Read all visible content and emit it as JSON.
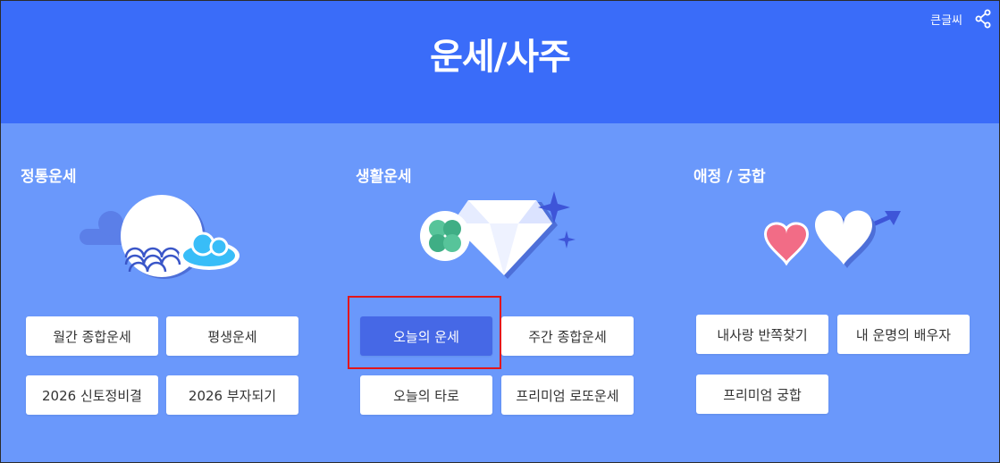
{
  "header": {
    "title": "운세/사주",
    "font_size_label": "큰글씨"
  },
  "icons": {
    "share": "share-icon",
    "moon": "moon-cloud-illustration",
    "gem": "diamond-clover-illustration",
    "hearts": "hearts-arrow-illustration"
  },
  "colors": {
    "header_bg": "#3a6cf9",
    "content_bg": "#6a98fb",
    "active_button": "#4668e6",
    "highlight_border": "#e3151a"
  },
  "sections": [
    {
      "title": "정통운세",
      "buttons": [
        "월간 종합운세",
        "평생운세",
        "2026 신토정비결",
        "2026 부자되기"
      ]
    },
    {
      "title": "생활운세",
      "buttons": [
        "오늘의 운세",
        "주간 종합운세",
        "오늘의 타로",
        "프리미엄 로또운세"
      ]
    },
    {
      "title": "애정 / 궁합",
      "buttons": [
        "내사랑 반쪽찾기",
        "내 운명의 배우자",
        "프리미엄 궁합"
      ]
    }
  ],
  "selected_button": "오늘의 운세"
}
